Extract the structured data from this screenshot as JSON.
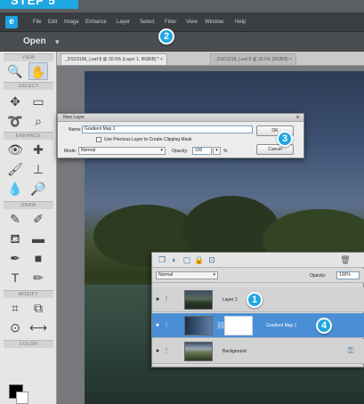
{
  "step": {
    "label": "STEP 5"
  },
  "menu": {
    "logo": "e",
    "items": [
      "File",
      "Edit",
      "Image",
      "Enhance",
      "Layer",
      "Select",
      "Filter",
      "View",
      "Window",
      "Help"
    ]
  },
  "openbar": {
    "open_label": "Open",
    "caret": "▾"
  },
  "tabs": [
    {
      "label": "_DSC0186_Leaf 8 @ 20.5% (Layer 1, RGB/8) *",
      "close": "×"
    },
    {
      "label": "_DSC0218_Leaf 8 @ 20.5% (RGB/8)",
      "close": "×"
    }
  ],
  "toolbox": {
    "sections": [
      "VIEW",
      "SELECT",
      "ENHANCE",
      "DRAW",
      "MODIFY",
      "COLOR"
    ]
  },
  "badges": {
    "b1": "1",
    "b2": "2",
    "b3": "3",
    "b4": "4"
  },
  "dialog": {
    "title": "New Layer",
    "close": "×",
    "name_label": "Name:",
    "name_value": "Gradient Map 1",
    "clip_label": "Use Previous Layer to Create Clipping Mask",
    "mode_label": "Mode:",
    "mode_value": "Normal",
    "opacity_label": "Opacity:",
    "opacity_value": "100",
    "percent": "%",
    "ok_label": "OK",
    "cancel_label": "Cancel"
  },
  "layers": {
    "blend_mode": "Normal",
    "opacity_label": "Opacity:",
    "opacity_value": "100%",
    "rows": [
      {
        "name": "Layer 1"
      },
      {
        "name": "Gradient Map 1"
      },
      {
        "name": "Background"
      }
    ]
  },
  "colors": {
    "accent": "#1ea7e1",
    "selected_row": "#4a8fd6"
  }
}
